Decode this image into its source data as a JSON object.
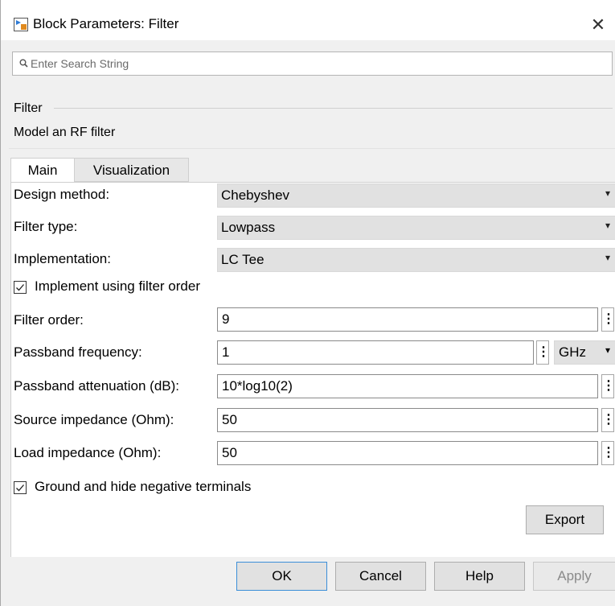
{
  "window": {
    "title": "Block Parameters: Filter",
    "close_label": "✕"
  },
  "search": {
    "placeholder": "Enter Search String"
  },
  "section": {
    "title": "Filter",
    "description": "Model an RF filter"
  },
  "tabs": [
    {
      "label": "Main",
      "active": true
    },
    {
      "label": "Visualization",
      "active": false
    }
  ],
  "params": {
    "design_method": {
      "label": "Design method:",
      "value": "Chebyshev"
    },
    "filter_type": {
      "label": "Filter type:",
      "value": "Lowpass"
    },
    "implementation": {
      "label": "Implementation:",
      "value": "LC Tee"
    },
    "implement_order": {
      "label": "Implement using filter order",
      "checked": true
    },
    "filter_order": {
      "label": "Filter order:",
      "value": "9"
    },
    "passband_freq": {
      "label": "Passband frequency:",
      "value": "1",
      "unit": "GHz"
    },
    "passband_atten": {
      "label": "Passband attenuation (dB):",
      "value": "10*log10(2)"
    },
    "source_imp": {
      "label": "Source impedance (Ohm):",
      "value": "50"
    },
    "load_imp": {
      "label": "Load impedance (Ohm):",
      "value": "50"
    },
    "ground_hide": {
      "label": "Ground and hide negative terminals",
      "checked": true
    }
  },
  "buttons": {
    "export": "Export",
    "ok": "OK",
    "cancel": "Cancel",
    "help": "Help",
    "apply": "Apply"
  },
  "glyphs": {
    "kebab": "⋮",
    "caret": "▾",
    "check": "✓"
  }
}
